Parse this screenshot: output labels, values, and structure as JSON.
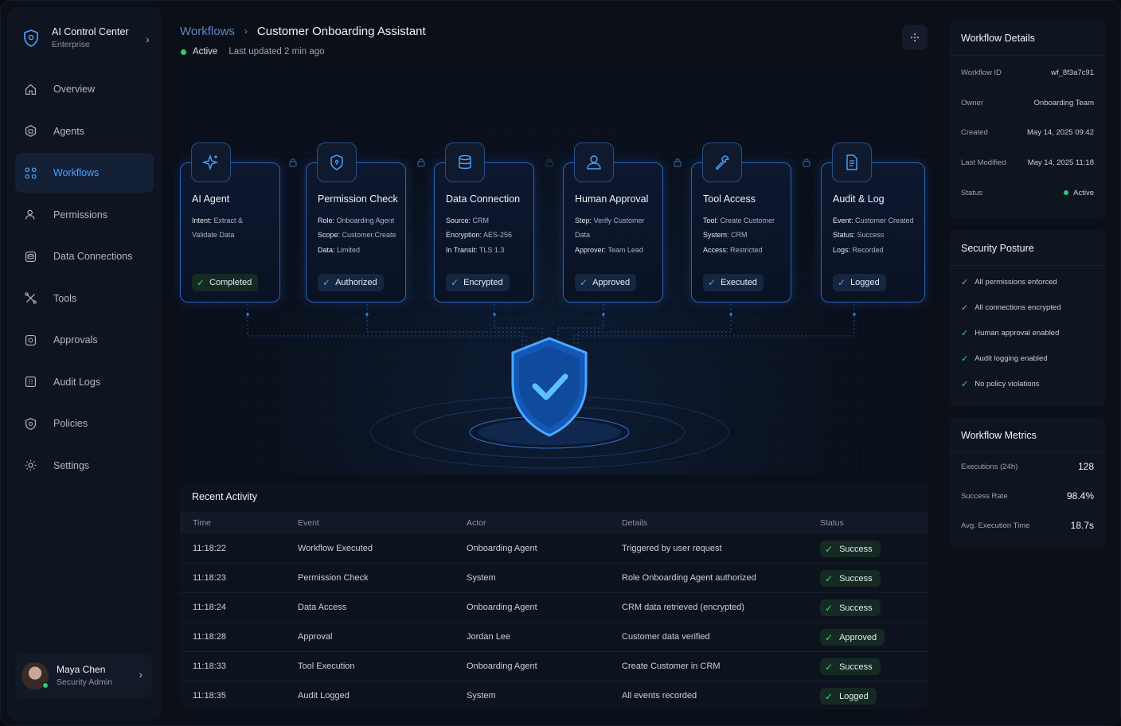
{
  "brand": {
    "title": "AI Control Center",
    "subtitle": "Enterprise"
  },
  "nav": [
    {
      "label": "Overview",
      "icon": "home-icon"
    },
    {
      "label": "Agents",
      "icon": "agent-icon"
    },
    {
      "label": "Workflows",
      "icon": "workflow-icon",
      "active": true
    },
    {
      "label": "Permissions",
      "icon": "users-icon"
    },
    {
      "label": "Data Connections",
      "icon": "database-icon"
    },
    {
      "label": "Tools",
      "icon": "tools-icon"
    },
    {
      "label": "Approvals",
      "icon": "approval-icon"
    },
    {
      "label": "Audit Logs",
      "icon": "audit-icon"
    },
    {
      "label": "Policies",
      "icon": "shield-icon"
    },
    {
      "label": "Settings",
      "icon": "gear-icon"
    }
  ],
  "user": {
    "name": "Maya Chen",
    "role": "Security Admin"
  },
  "header": {
    "breadcrumb_parent": "Workflows",
    "breadcrumb_current": "Customer Onboarding Assistant",
    "status": "Active",
    "updated": "Last updated 2 min ago"
  },
  "steps": [
    {
      "title": "AI Agent",
      "icon": "sparkle-icon",
      "lines": [
        [
          "Intent:",
          " Extract &"
        ],
        [
          "",
          "Validate Data"
        ]
      ],
      "badge": "Completed",
      "badge_color": "green"
    },
    {
      "title": "Permission Check",
      "icon": "shield-lock-icon",
      "lines": [
        [
          "Role:",
          " Onboarding Agent"
        ],
        [
          "Scope:",
          " Customer.Create"
        ],
        [
          "Data:",
          " Limited"
        ]
      ],
      "badge": "Authorized",
      "badge_color": "blue"
    },
    {
      "title": "Data Connection",
      "icon": "database-icon",
      "lines": [
        [
          "Source:",
          " CRM"
        ],
        [
          "Encryption:",
          " AES-256"
        ],
        [
          "In Transit:",
          " TLS 1.3"
        ]
      ],
      "badge": "Encrypted",
      "badge_color": "blue"
    },
    {
      "title": "Human Approval",
      "icon": "user-icon",
      "lines": [
        [
          "Step:",
          " Verify Customer"
        ],
        [
          "",
          "Data"
        ],
        [
          "Approver:",
          " Team Lead"
        ]
      ],
      "badge": "Approved",
      "badge_color": "blue"
    },
    {
      "title": "Tool Access",
      "icon": "wrench-icon",
      "lines": [
        [
          "Tool:",
          " Create Customer"
        ],
        [
          "System:",
          " CRM"
        ],
        [
          "Access:",
          " Restricted"
        ]
      ],
      "badge": "Executed",
      "badge_color": "blue"
    },
    {
      "title": "Audit & Log",
      "icon": "document-icon",
      "lines": [
        [
          "Event:",
          " Customer Created"
        ],
        [
          "Status:",
          " Success"
        ],
        [
          "Logs:",
          " Recorded"
        ]
      ],
      "badge": "Logged",
      "badge_color": "blue"
    }
  ],
  "activity": {
    "title": "Recent Activity",
    "columns": [
      "Time",
      "Event",
      "Actor",
      "Details",
      "Status"
    ],
    "rows": [
      [
        "11:18:22",
        "Workflow Executed",
        "Onboarding Agent",
        "Triggered by user request",
        "Success"
      ],
      [
        "11:18:23",
        "Permission Check",
        "System",
        "Role Onboarding Agent authorized",
        "Success"
      ],
      [
        "11:18:24",
        "Data Access",
        "Onboarding Agent",
        "CRM data retrieved (encrypted)",
        "Success"
      ],
      [
        "11:18:28",
        "Approval",
        "Jordan Lee",
        "Customer data verified",
        "Approved"
      ],
      [
        "11:18:33",
        "Tool Execution",
        "Onboarding Agent",
        "Create Customer in CRM",
        "Success"
      ],
      [
        "11:18:35",
        "Audit Logged",
        "System",
        "All events recorded",
        "Logged"
      ]
    ]
  },
  "details": {
    "title": "Workflow Details",
    "items": [
      [
        "Workflow ID",
        "wf_8f3a7c91"
      ],
      [
        "Owner",
        "Onboarding Team"
      ],
      [
        "Created",
        "May 14, 2025 09:42"
      ],
      [
        "Last Modified",
        "May 14, 2025 11:18"
      ],
      [
        "Status",
        "Active"
      ]
    ]
  },
  "security": {
    "title": "Security Posture",
    "items": [
      "All permissions enforced",
      "All connections encrypted",
      "Human approval enabled",
      "Audit logging enabled",
      "No policy violations"
    ]
  },
  "metrics": {
    "title": "Workflow Metrics",
    "items": [
      [
        "Executions (24h)",
        "128"
      ],
      [
        "Success Rate",
        "98.4%"
      ],
      [
        "Avg. Execution Time",
        "18.7s"
      ]
    ]
  }
}
